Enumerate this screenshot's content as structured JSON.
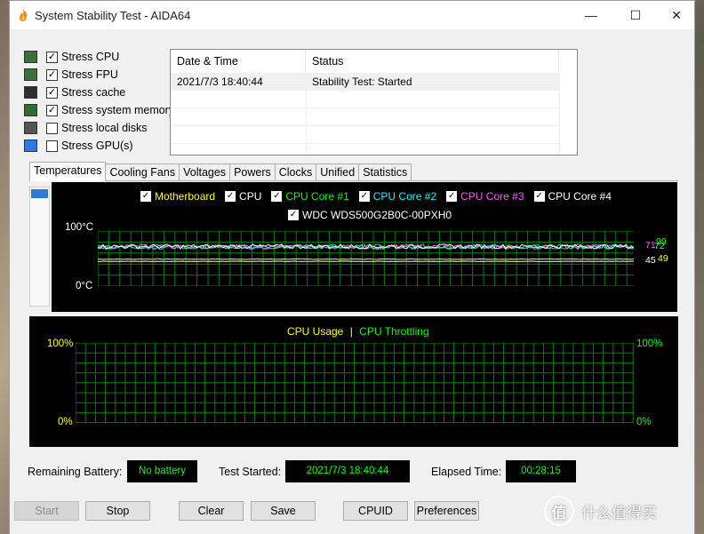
{
  "window": {
    "title": "System Stability Test - AIDA64",
    "caption": {
      "minimize": "—",
      "maximize": "☐",
      "close": "✕"
    }
  },
  "stress_options": [
    {
      "label": "Stress CPU",
      "checked": true,
      "icon": "cpu-chip-icon"
    },
    {
      "label": "Stress FPU",
      "checked": true,
      "icon": "fpu-percent-icon"
    },
    {
      "label": "Stress cache",
      "checked": true,
      "icon": "cache-chip-icon"
    },
    {
      "label": "Stress system memory",
      "checked": true,
      "icon": "memory-module-icon"
    },
    {
      "label": "Stress local disks",
      "checked": false,
      "icon": "disk-drive-icon"
    },
    {
      "label": "Stress GPU(s)",
      "checked": false,
      "icon": "monitor-gpu-icon"
    }
  ],
  "log": {
    "columns": [
      "Date & Time",
      "Status"
    ],
    "rows": [
      {
        "datetime": "2021/7/3 18:40:44",
        "status": "Stability Test: Started"
      }
    ]
  },
  "tabs": [
    "Temperatures",
    "Cooling Fans",
    "Voltages",
    "Powers",
    "Clocks",
    "Unified",
    "Statistics"
  ],
  "active_tab": "Temperatures",
  "temperature_graph": {
    "legend": [
      {
        "name": "Motherboard",
        "color": "#ffff00",
        "checked": true
      },
      {
        "name": "CPU",
        "color": "#ffffff",
        "checked": true
      },
      {
        "name": "CPU Core #1",
        "color": "#00ff00",
        "checked": true
      },
      {
        "name": "CPU Core #2",
        "color": "#00ffff",
        "checked": true
      },
      {
        "name": "CPU Core #3",
        "color": "#ff55ff",
        "checked": true
      },
      {
        "name": "CPU Core #4",
        "color": "#ffffff",
        "checked": true
      },
      {
        "name": "WDC WDS500G2B0C-00PXH0",
        "color": "#ffffff",
        "checked": true
      }
    ],
    "y_max_label": "100°C",
    "y_min_label": "0°C",
    "readouts": [
      {
        "value": "71",
        "color": "#ff55ff"
      },
      {
        "value": "72",
        "color": "#00ffff"
      },
      {
        "value": "99",
        "color": "#00ff00"
      },
      {
        "value": "45",
        "color": "#ffffff"
      },
      {
        "value": "49",
        "color": "#ffff00"
      }
    ],
    "grid_color": "#008000"
  },
  "cpu_graph": {
    "title_usage": "CPU Usage",
    "separator": "|",
    "title_throttling": "CPU Throttling",
    "usage_color": "#ffff00",
    "throttling_color": "#00ff00",
    "left_max": "100%",
    "left_min": "0%",
    "right_max": "100%",
    "right_min": "0%",
    "grid_color": "#008000"
  },
  "status": {
    "battery_label": "Remaining Battery:",
    "battery_value": "No battery",
    "started_label": "Test Started:",
    "started_value": "2021/7/3 18:40:44",
    "elapsed_label": "Elapsed Time:",
    "elapsed_value": "00:28:15"
  },
  "buttons": {
    "start": "Start",
    "stop": "Stop",
    "clear": "Clear",
    "save": "Save",
    "cpuid": "CPUID",
    "preferences": "Preferences"
  },
  "watermark": {
    "logo": "值",
    "text": "什么值得买"
  }
}
